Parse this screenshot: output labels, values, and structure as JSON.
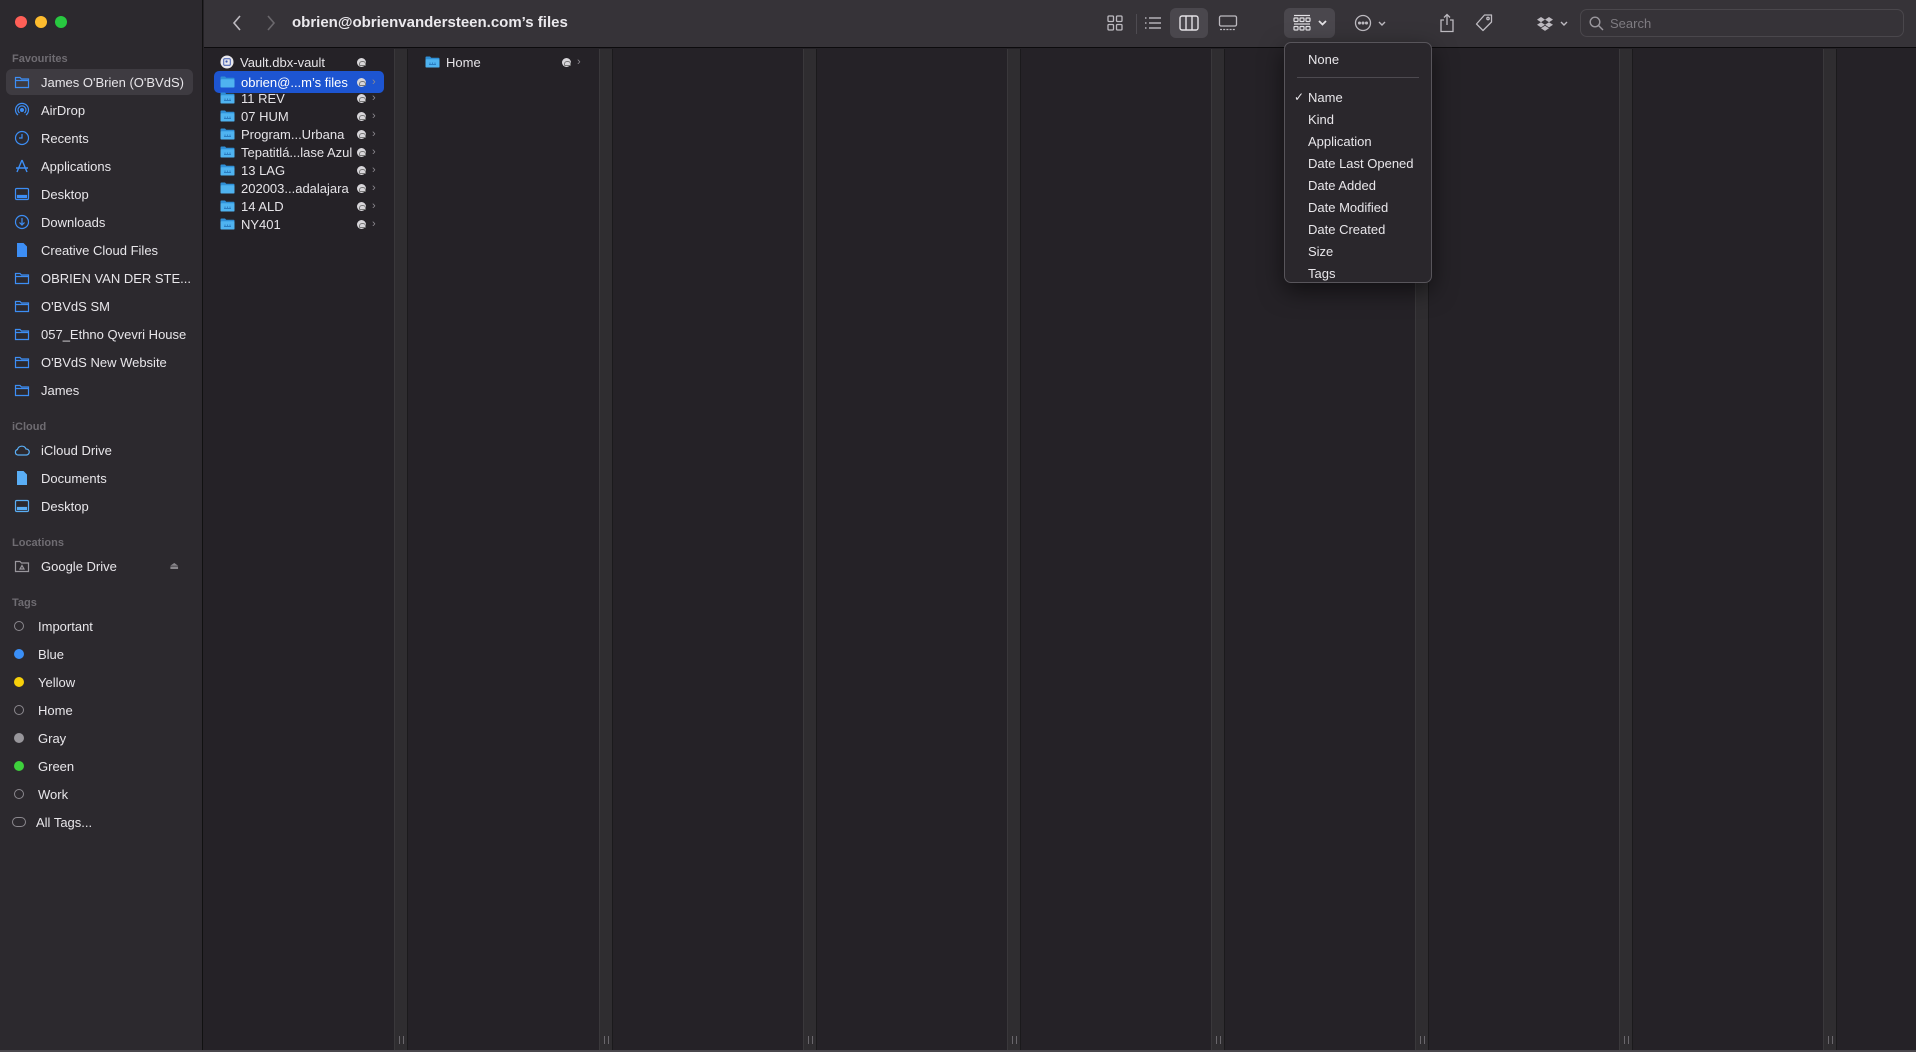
{
  "window": {
    "title": "obrien@obrienvandersteen.com’s files"
  },
  "traffic_lights": {
    "close_color": "#ff5f57",
    "minimize_color": "#febc2e",
    "zoom_color": "#28c840"
  },
  "sidebar": {
    "favourites_heading": "Favourites",
    "favourites": [
      {
        "label": "James O'Brien (O'BVdS)",
        "icon": "folder-icon",
        "active": true
      },
      {
        "label": "AirDrop",
        "icon": "airdrop-icon"
      },
      {
        "label": "Recents",
        "icon": "clock-icon"
      },
      {
        "label": "Applications",
        "icon": "applications-icon"
      },
      {
        "label": "Desktop",
        "icon": "desktop-icon"
      },
      {
        "label": "Downloads",
        "icon": "download-icon"
      },
      {
        "label": "Creative Cloud Files",
        "icon": "document-icon"
      },
      {
        "label": "OBRIEN VAN DER STE...",
        "icon": "folder-icon"
      },
      {
        "label": "O'BVdS SM",
        "icon": "folder-icon"
      },
      {
        "label": "057_Ethno Qvevri House",
        "icon": "folder-icon"
      },
      {
        "label": "O'BVdS New Website",
        "icon": "folder-icon"
      },
      {
        "label": "James",
        "icon": "folder-icon"
      }
    ],
    "icloud_heading": "iCloud",
    "icloud": [
      {
        "label": "iCloud Drive",
        "icon": "cloud-icon"
      },
      {
        "label": "Documents",
        "icon": "document-icon"
      },
      {
        "label": "Desktop",
        "icon": "desktop-icon"
      }
    ],
    "locations_heading": "Locations",
    "locations": [
      {
        "label": "Google Drive",
        "icon": "drive-icon",
        "ejectable": true
      }
    ],
    "tags_heading": "Tags",
    "tags": [
      {
        "label": "Important",
        "color": null
      },
      {
        "label": "Blue",
        "color": "#3a8ff7"
      },
      {
        "label": "Yellow",
        "color": "#f7d00a"
      },
      {
        "label": "Home",
        "color": null
      },
      {
        "label": "Gray",
        "color": "#98969b"
      },
      {
        "label": "Green",
        "color": "#3ed13c"
      },
      {
        "label": "Work",
        "color": null
      },
      {
        "label": "All Tags...",
        "color": "all"
      }
    ]
  },
  "toolbar": {
    "back_label": "Back",
    "forward_label": "Forward",
    "view_modes": [
      "icon",
      "list",
      "column",
      "gallery"
    ],
    "selected_view": "column",
    "search_placeholder": "Search",
    "search_value": ""
  },
  "columns": [
    {
      "items": [
        {
          "name": "Vault.dbx-vault",
          "type": "vault",
          "cloud": true,
          "has_children": false
        },
        {
          "name": "obrien@...m’s files",
          "type": "folder",
          "cloud": true,
          "has_children": true,
          "selected": true
        },
        {
          "name": "11 REV",
          "type": "shared-folder",
          "cloud": true,
          "has_children": true
        },
        {
          "name": "07 HUM",
          "type": "shared-folder",
          "cloud": true,
          "has_children": true
        },
        {
          "name": "Program...Urbana",
          "type": "shared-folder",
          "cloud": true,
          "has_children": true
        },
        {
          "name": "Tepatitlá...lase Azul",
          "type": "shared-folder",
          "cloud": true,
          "has_children": true
        },
        {
          "name": "13 LAG",
          "type": "shared-folder",
          "cloud": true,
          "has_children": true
        },
        {
          "name": "202003...adalajara",
          "type": "folder",
          "cloud": true,
          "has_children": true
        },
        {
          "name": "14 ALD",
          "type": "shared-folder",
          "cloud": true,
          "has_children": true
        },
        {
          "name": "NY401",
          "type": "shared-folder",
          "cloud": true,
          "has_children": true
        }
      ]
    },
    {
      "items": [
        {
          "name": "Home",
          "type": "shared-folder",
          "cloud": true,
          "has_children": true
        }
      ]
    }
  ],
  "group_menu": {
    "items": [
      {
        "label": "None",
        "checked": false
      },
      {
        "separator": true
      },
      {
        "label": "Name",
        "checked": true
      },
      {
        "label": "Kind",
        "checked": false
      },
      {
        "label": "Application",
        "checked": false
      },
      {
        "label": "Date Last Opened",
        "checked": false
      },
      {
        "label": "Date Added",
        "checked": false
      },
      {
        "label": "Date Modified",
        "checked": false
      },
      {
        "label": "Date Created",
        "checked": false
      },
      {
        "label": "Size",
        "checked": false
      },
      {
        "label": "Tags",
        "checked": false
      }
    ],
    "check_glyph": "✓"
  }
}
